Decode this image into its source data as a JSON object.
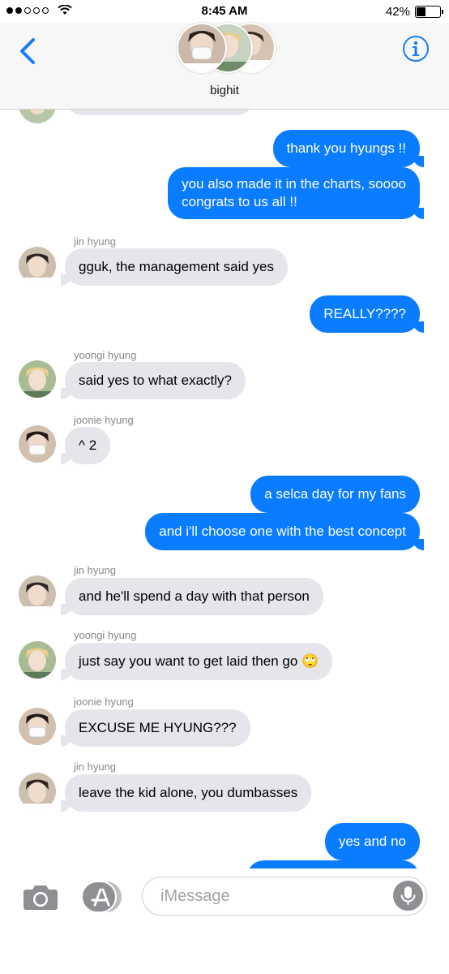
{
  "status": {
    "time": "8:45 AM",
    "battery": "42%",
    "battery_level": 0.42
  },
  "header": {
    "group_name": "bighit"
  },
  "messages": [
    {
      "from": "me",
      "text": "thank you hyungs !!"
    },
    {
      "from": "me",
      "line1": "you also made it in the charts, soooo",
      "line2": "congrats to us all !!"
    },
    {
      "from": "jin hyung",
      "text": "gguk, the management said yes"
    },
    {
      "from": "me",
      "text": "REALLY????"
    },
    {
      "from": "yoongi hyung",
      "text": "said yes to what exactly?"
    },
    {
      "from": "joonie hyung",
      "text": "^ 2"
    },
    {
      "from": "me",
      "text": "a selca day for my fans"
    },
    {
      "from": "me",
      "text": "and i'll choose one with the best concept"
    },
    {
      "from": "jin hyung",
      "text": "and he'll spend a day with that person"
    },
    {
      "from": "yoongi hyung",
      "text": "just say you want to get laid then go 🙄"
    },
    {
      "from": "joonie hyung",
      "text": "EXCUSE ME HYUNG???"
    },
    {
      "from": "jin hyung",
      "text": "leave the kid alone, you dumbasses"
    },
    {
      "from": "me",
      "text": "yes and no"
    }
  ],
  "compose": {
    "placeholder": "iMessage"
  },
  "colors": {
    "sent": "#0a7cff",
    "received": "#e6e5eb",
    "accent": "#1a7cf6"
  }
}
